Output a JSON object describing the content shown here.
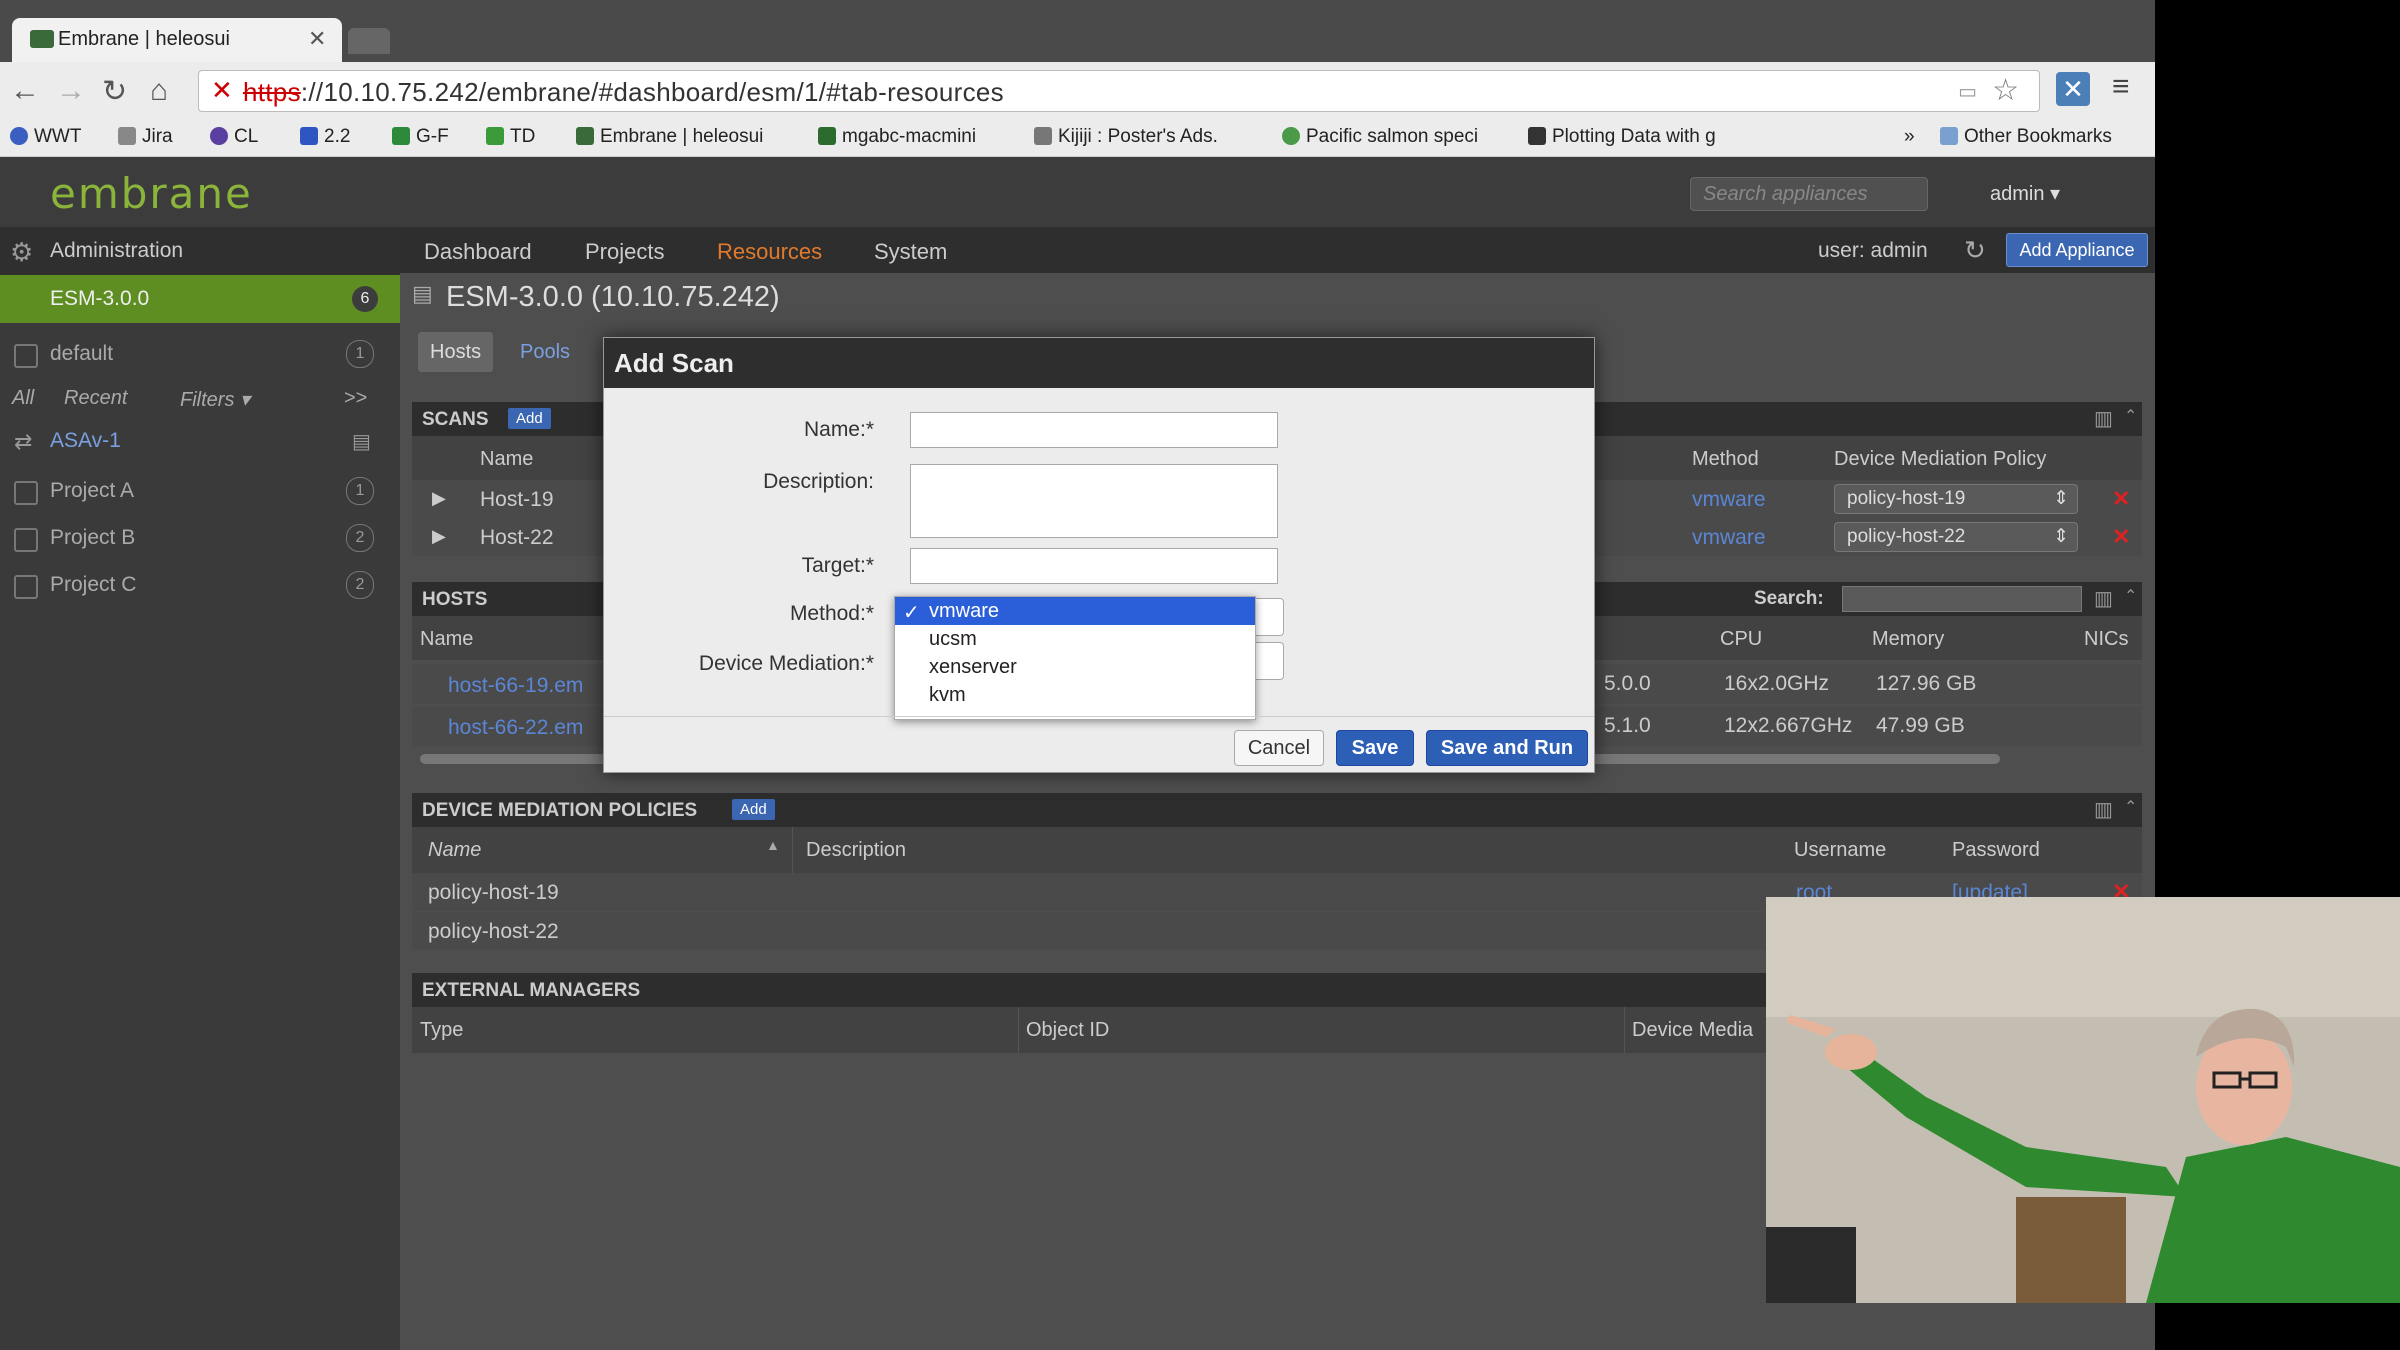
{
  "browser": {
    "tab_title": "Embrane | heleosui",
    "url_scheme": "https",
    "url_rest": "://10.10.75.242/embrane/#dashboard/esm/1/#tab-resources",
    "bookmarks": [
      "WWT",
      "Jira",
      "CL",
      "2.2",
      "G-F",
      "TD",
      "Embrane | heleosui",
      "mgabc-macmini",
      "Kijiji : Poster's Ads.",
      "Pacific salmon speci",
      "Plotting Data with g"
    ],
    "overflow": "»",
    "other_bookmarks": "Other Bookmarks"
  },
  "app": {
    "logo": "embrane",
    "search_placeholder": "Search appliances",
    "admin_menu": "admin ▾",
    "nav": [
      "Dashboard",
      "Projects",
      "Resources",
      "System"
    ],
    "user": "user: admin",
    "add_appliance": "Add Appliance",
    "accent": "#e07a2c"
  },
  "sidebar": {
    "admin": "Administration",
    "esm": {
      "label": "ESM-3.0.0",
      "count": "6"
    },
    "default": {
      "label": "default",
      "count": "1"
    },
    "filters": {
      "all": "All",
      "recent": "Recent",
      "filters": "Filters ▾",
      "more": ">>"
    },
    "asav": "ASAv-1",
    "projects": [
      {
        "label": "Project A",
        "count": "1"
      },
      {
        "label": "Project B",
        "count": "2"
      },
      {
        "label": "Project C",
        "count": "2"
      }
    ]
  },
  "main": {
    "title": "ESM-3.0.0 (10.10.75.242)",
    "tabs": [
      "Hosts",
      "Pools"
    ],
    "scans": {
      "header": "SCANS",
      "add": "Add",
      "columns": {
        "name": "Name",
        "method": "Method",
        "policy": "Device Mediation Policy"
      },
      "rows": [
        {
          "name": "Host-19",
          "method": "vmware",
          "policy": "policy-host-19"
        },
        {
          "name": "Host-22",
          "method": "vmware",
          "policy": "policy-host-22"
        }
      ]
    },
    "hosts": {
      "header": "HOSTS",
      "search_label": "Search:",
      "columns": {
        "name": "Name",
        "cpu": "CPU",
        "memory": "Memory",
        "nics": "NICs"
      },
      "rows": [
        {
          "name": "host-66-19.em",
          "ver": "5.0.0",
          "cpu": "16x2.0GHz",
          "memory": "127.96 GB"
        },
        {
          "name": "host-66-22.em",
          "ver": "5.1.0",
          "cpu": "12x2.667GHz",
          "memory": "47.99 GB"
        }
      ]
    },
    "dmp": {
      "header": "DEVICE MEDIATION POLICIES",
      "add": "Add",
      "columns": {
        "name": "Name",
        "description": "Description",
        "username": "Username",
        "password": "Password"
      },
      "rows": [
        {
          "name": "policy-host-19",
          "username": "root",
          "password": "[update]"
        },
        {
          "name": "policy-host-22"
        }
      ]
    },
    "ext": {
      "header": "EXTERNAL MANAGERS",
      "columns": {
        "type": "Type",
        "object_id": "Object ID",
        "device_media": "Device Media"
      }
    }
  },
  "modal": {
    "title": "Add Scan",
    "name_label": "Name:*",
    "desc_label": "Description:",
    "target_label": "Target:*",
    "method_label": "Method:*",
    "dm_label": "Device Mediation:*",
    "method_options": [
      "vmware",
      "ucsm",
      "xenserver",
      "kvm"
    ],
    "selected_method": "vmware",
    "checkmark": "✓",
    "cancel": "Cancel",
    "save": "Save",
    "save_and_run": "Save and Run"
  }
}
